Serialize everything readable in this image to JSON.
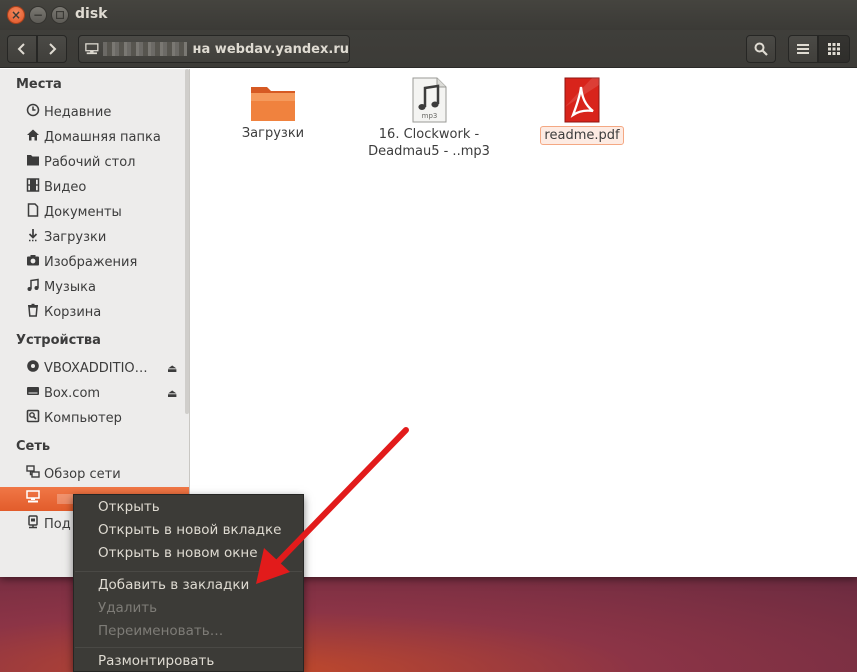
{
  "window": {
    "title": "disk",
    "path_suffix": "на webdav.yandex.ru"
  },
  "sidebar": {
    "places_header": "Места",
    "places": [
      {
        "label": "Недавние",
        "icon": "clock-icon"
      },
      {
        "label": "Домашняя папка",
        "icon": "home-icon"
      },
      {
        "label": "Рабочий стол",
        "icon": "desktop-folder-icon"
      },
      {
        "label": "Видео",
        "icon": "film-icon"
      },
      {
        "label": "Документы",
        "icon": "document-icon"
      },
      {
        "label": "Загрузки",
        "icon": "download-icon"
      },
      {
        "label": "Изображения",
        "icon": "camera-icon"
      },
      {
        "label": "Музыка",
        "icon": "music-icon"
      },
      {
        "label": "Корзина",
        "icon": "trash-icon"
      }
    ],
    "devices_header": "Устройства",
    "devices": [
      {
        "label": "VBOXADDITIO…",
        "icon": "disc-icon"
      },
      {
        "label": "Box.com",
        "icon": "drive-icon"
      },
      {
        "label": "Компьютер",
        "icon": "computer-icon"
      }
    ],
    "network_header": "Сеть",
    "network": [
      {
        "label": "Обзор сети",
        "icon": "network-icon"
      },
      {
        "label": "Под",
        "icon": "server-icon"
      }
    ]
  },
  "files": [
    {
      "name": "Загрузки",
      "icon": "folder-icon"
    },
    {
      "name_line1": "16. Clockwork -",
      "name_line2": "Deadmau5 - ..mp3",
      "icon": "mp3-icon"
    },
    {
      "name": "readme.pdf",
      "icon": "pdf-icon"
    }
  ],
  "context_menu": {
    "items": [
      {
        "label": "Открыть",
        "disabled": false
      },
      {
        "label": "Открыть в новой вкладке",
        "disabled": false
      },
      {
        "label": "Открыть в новом окне",
        "disabled": false
      },
      {
        "label": "Добавить в закладки",
        "disabled": false
      },
      {
        "label": "Удалить",
        "disabled": true
      },
      {
        "label": "Переименовать…",
        "disabled": true
      },
      {
        "label": "Размонтировать",
        "disabled": false
      }
    ]
  },
  "colors": {
    "accent": "#e8622f",
    "arrow": "#e21b1b"
  }
}
